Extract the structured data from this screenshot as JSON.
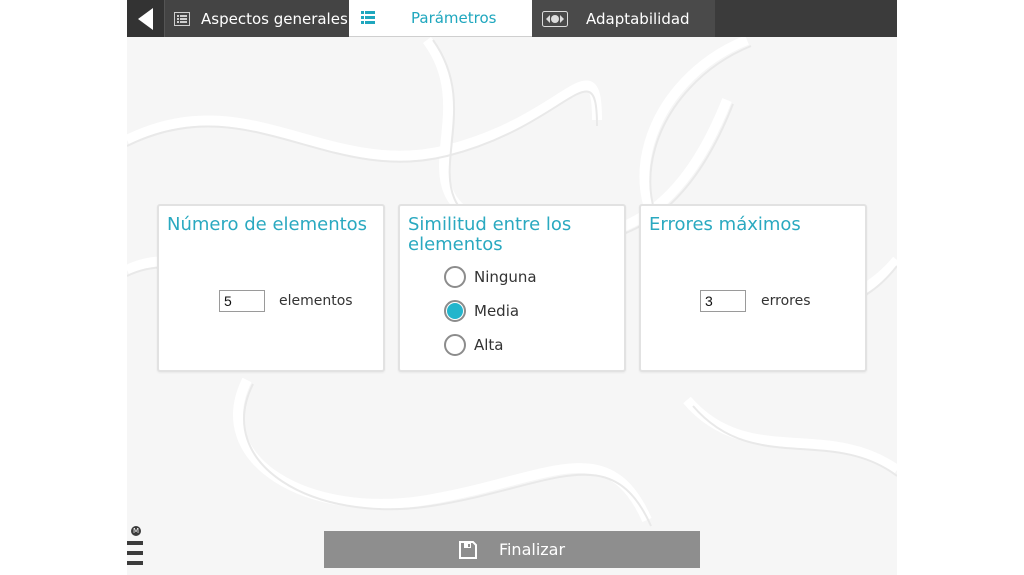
{
  "tabs": {
    "general": "Aspectos generales",
    "params": "Parámetros",
    "adapt": "Adaptabilidad"
  },
  "cards": {
    "count": {
      "title": "Número de elementos",
      "value": "5",
      "unit": "elementos"
    },
    "similarity": {
      "title": "Similitud entre los elementos",
      "options": [
        "Ninguna",
        "Media",
        "Alta"
      ],
      "selected": "Media"
    },
    "errors": {
      "title": "Errores máximos",
      "value": "3",
      "unit": "errores"
    }
  },
  "finish_label": "Finalizar",
  "menu_badge": "M",
  "colors": {
    "accent": "#2aa9c0",
    "radio_selected": "#22b5cc",
    "topbar": "#3b3b3b",
    "finish_button": "#8e8e8e"
  }
}
